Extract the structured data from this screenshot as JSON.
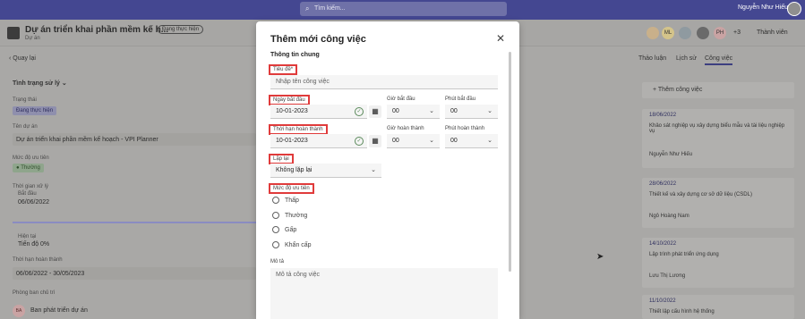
{
  "topbar": {
    "search_placeholder": "Tìm kiếm...",
    "user_name": "Nguyễn Như Hiếu"
  },
  "project": {
    "title": "Dự án triển khai phần mềm kế h...",
    "subtitle": "Dự án",
    "status": "Đang thực hiện",
    "member_avatars": [
      "ML",
      "PH"
    ],
    "member_more": "+3",
    "members_label": "Thành viên"
  },
  "left_panel": {
    "back_label": "Quay lại",
    "section_title": "Tình trạng sử lý",
    "fields": {
      "status_label": "Trạng thái",
      "status_value": "Đang thực hiện",
      "name_label": "Tên dự án",
      "name_value": "Dự án triển khai phần mềm kế hoạch - VPI Planner",
      "priority_label": "Mức độ ưu tiên",
      "priority_value": "Thường",
      "time_label": "Thời gian xử lý",
      "start_label": "Bắt đầu",
      "start_value": "06/06/2022",
      "now_label": "Hiện tại",
      "progress_value": "Tiến độ 0%",
      "deadline_label": "Thời hạn hoàn thành",
      "deadline_value": "06/06/2022 - 30/05/2023",
      "dept_label": "Phòng ban chủ trì",
      "dept_avatar": "BA",
      "dept_value": "Ban phát triển dự án"
    }
  },
  "right_panel": {
    "tabs": [
      "Thảo luận",
      "Lịch sử",
      "Công việc"
    ],
    "active_tab": "Công việc",
    "add_task_label": "Thêm công việc",
    "cards": [
      {
        "date": "18/06/2022",
        "task": "Khảo sát nghiệp vụ xây dựng biểu mẫu và tài liệu nghiệp vụ",
        "person": "Nguyễn Như Hiếu"
      },
      {
        "date": "28/06/2022",
        "task": "Thiết kế và xây dựng cơ sở dữ liệu (CSDL)",
        "person": "Ngô Hoàng Nam"
      },
      {
        "date": "14/10/2022",
        "task": "Lập trình phát triển ứng dụng",
        "person": "Lưu Thị Lương"
      },
      {
        "date": "11/10/2022",
        "task": "Thiết lập cấu hình hệ thống"
      }
    ]
  },
  "modal": {
    "title": "Thêm mới công việc",
    "section": "Thông tin chung",
    "title_label": "Tiêu đề*",
    "title_placeholder": "Nhập tên công việc",
    "start_date_label": "Ngày bắt đầu",
    "start_date_value": "10-01-2023",
    "start_hour_label": "Giờ bắt đầu",
    "start_hour_value": "00",
    "start_minute_label": "Phút bắt đầu",
    "start_minute_value": "00",
    "deadline_label": "Thời hạn hoàn thành",
    "deadline_value": "10-01-2023",
    "end_hour_label": "Giờ hoàn thành",
    "end_hour_value": "00",
    "end_minute_label": "Phút hoàn thành",
    "end_minute_value": "00",
    "repeat_label": "Lặp lại",
    "repeat_value": "Không lặp lại",
    "priority_label": "Mức độ ưu tiên",
    "priority_options": [
      "Thấp",
      "Thường",
      "Gấp",
      "Khẩn cấp"
    ],
    "description_label": "Mô tả",
    "description_placeholder": "Mô tả công việc"
  },
  "colors": {
    "topbar": "#444791",
    "highlight_border": "#e03b3b",
    "modal_bg": "#ffffff"
  }
}
